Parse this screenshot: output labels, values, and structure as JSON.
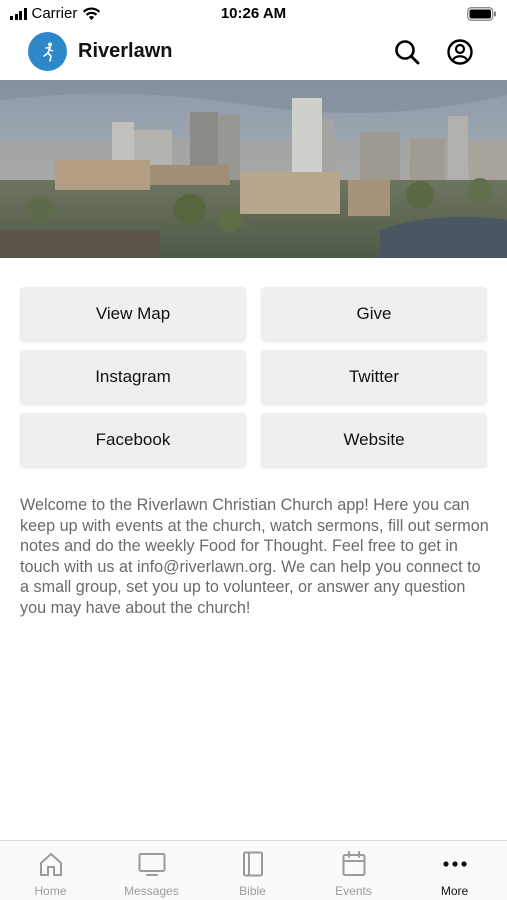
{
  "status_bar": {
    "carrier": "Carrier",
    "time": "10:26 AM"
  },
  "header": {
    "title": "Riverlawn"
  },
  "buttons": [
    {
      "label": "View Map"
    },
    {
      "label": "Give"
    },
    {
      "label": "Instagram"
    },
    {
      "label": "Twitter"
    },
    {
      "label": "Facebook"
    },
    {
      "label": "Website"
    }
  ],
  "welcome_text": "Welcome to the Riverlawn Christian Church app! Here you can keep up with events at the church, watch sermons, fill out sermon notes and do the weekly Food for Thought. Feel free to get in touch with us at info@riverlawn.org. We can help you connect to a small group, set you up to volunteer, or answer any question you may have about the church!",
  "tabs": [
    {
      "label": "Home",
      "icon": "home-icon",
      "active": false
    },
    {
      "label": "Messages",
      "icon": "tv-icon",
      "active": false
    },
    {
      "label": "Bible",
      "icon": "book-icon",
      "active": false
    },
    {
      "label": "Events",
      "icon": "calendar-icon",
      "active": false
    },
    {
      "label": "More",
      "icon": "ellipsis-icon",
      "active": true
    }
  ],
  "colors": {
    "brand": "#2c88c8",
    "button_bg": "#eeeff0",
    "text_muted": "#6b6b6b",
    "tab_inactive": "#9b9b9b"
  }
}
